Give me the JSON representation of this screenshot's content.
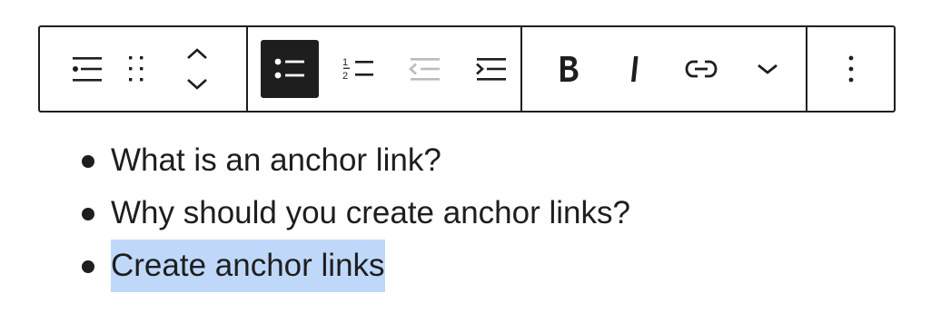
{
  "toolbar": {
    "block_tools": [
      {
        "name": "list-block-icon",
        "tooltip": "List"
      },
      {
        "name": "drag-handle-icon",
        "tooltip": "Drag"
      },
      {
        "name": "move-up-icon",
        "tooltip": "Move up"
      },
      {
        "name": "move-down-icon",
        "tooltip": "Move down"
      }
    ],
    "list_tools": [
      {
        "name": "unordered-list-icon",
        "active": true
      },
      {
        "name": "ordered-list-icon",
        "active": false
      },
      {
        "name": "outdent-icon",
        "active": false,
        "disabled": true
      },
      {
        "name": "indent-icon",
        "active": false
      }
    ],
    "format_tools": [
      {
        "name": "bold-icon"
      },
      {
        "name": "italic-icon"
      },
      {
        "name": "link-icon"
      },
      {
        "name": "chevron-down-icon"
      }
    ],
    "options": {
      "name": "more-options-icon"
    },
    "colors": {
      "border": "#1e1e1e",
      "active_bg": "#1e1e1e",
      "active_fg": "#ffffff",
      "disabled_fg": "#bbbbbb",
      "selection": "#bfd8fa"
    }
  },
  "list": {
    "items": [
      {
        "text": "What is an anchor link?",
        "selected": false
      },
      {
        "text": "Why should you create anchor links?",
        "selected": false
      },
      {
        "text": "Create anchor links",
        "selected": true
      }
    ]
  }
}
